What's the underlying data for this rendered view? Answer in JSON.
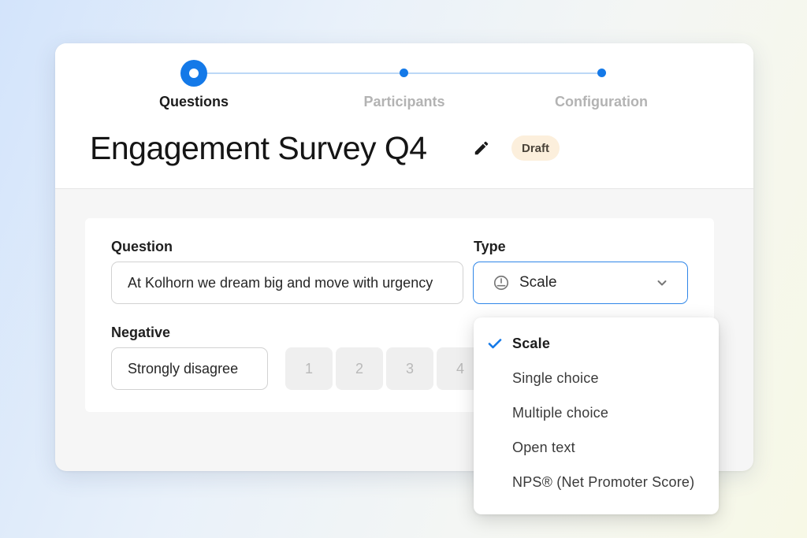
{
  "stepper": {
    "steps": [
      {
        "label": "Questions",
        "active": true
      },
      {
        "label": "Participants",
        "active": false
      },
      {
        "label": "Configuration",
        "active": false
      }
    ]
  },
  "survey": {
    "title": "Engagement Survey Q4",
    "status": "Draft"
  },
  "form": {
    "question_label": "Question",
    "question_value": "At Kolhorn we dream big and move with urgency",
    "type_label": "Type",
    "type_value": "Scale",
    "negative_label": "Negative",
    "negative_value": "Strongly disagree",
    "scale_values": [
      "1",
      "2",
      "3",
      "4"
    ]
  },
  "type_dropdown": {
    "selected": "Scale",
    "options": [
      "Scale",
      "Single choice",
      "Multiple choice",
      "Open text",
      "NPS® (Net Promoter Score)"
    ]
  },
  "icons": {
    "edit": "pencil-icon",
    "type": "gauge-icon",
    "chevron": "chevron-down-icon",
    "check": "check-icon"
  },
  "colors": {
    "accent": "#1479e8",
    "badge_bg": "#fcefdc",
    "card_bg": "#f6f6f6"
  }
}
